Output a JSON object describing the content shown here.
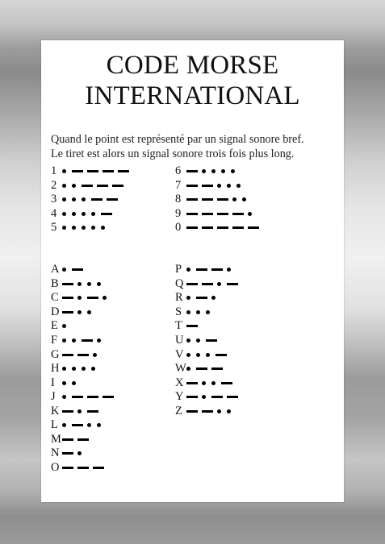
{
  "title": {
    "line1": "CODE MORSE",
    "line2": "INTERNATIONAL"
  },
  "intro": {
    "line1": "Quand le point est représenté par un signal sonore bref.",
    "line2": "Le tiret est alors un signal sonore trois fois plus long."
  },
  "numbers_left": [
    {
      "char": "1",
      "code": ".----"
    },
    {
      "char": "2",
      "code": "..---"
    },
    {
      "char": "3",
      "code": "...--"
    },
    {
      "char": "4",
      "code": "....-"
    },
    {
      "char": "5",
      "code": "....."
    }
  ],
  "numbers_right": [
    {
      "char": "6",
      "code": "-...."
    },
    {
      "char": "7",
      "code": "--..."
    },
    {
      "char": "8",
      "code": "---.."
    },
    {
      "char": "9",
      "code": "----."
    },
    {
      "char": "0",
      "code": "-----"
    }
  ],
  "letters_left": [
    {
      "char": "A",
      "code": ".-"
    },
    {
      "char": "B",
      "code": "-..."
    },
    {
      "char": "C",
      "code": "-.-."
    },
    {
      "char": "D",
      "code": "-.."
    },
    {
      "char": "E",
      "code": "."
    },
    {
      "char": "F",
      "code": "..-."
    },
    {
      "char": "G",
      "code": "--."
    },
    {
      "char": "H",
      "code": "...."
    },
    {
      "char": "I",
      "code": ".."
    },
    {
      "char": "J",
      "code": ".---"
    },
    {
      "char": "K",
      "code": "-.-"
    },
    {
      "char": "L",
      "code": ".-.."
    },
    {
      "char": "M",
      "code": "--"
    },
    {
      "char": "N",
      "code": "-."
    },
    {
      "char": "O",
      "code": "---"
    }
  ],
  "letters_right": [
    {
      "char": "P",
      "code": ".--."
    },
    {
      "char": "Q",
      "code": "--.-"
    },
    {
      "char": "R",
      "code": ".-."
    },
    {
      "char": "S",
      "code": "..."
    },
    {
      "char": "T",
      "code": "-"
    },
    {
      "char": "U",
      "code": "..-"
    },
    {
      "char": "V",
      "code": "...-"
    },
    {
      "char": "W",
      "code": ".--"
    },
    {
      "char": "X",
      "code": "-..-"
    },
    {
      "char": "Y",
      "code": "-.--"
    },
    {
      "char": "Z",
      "code": "--.."
    }
  ]
}
